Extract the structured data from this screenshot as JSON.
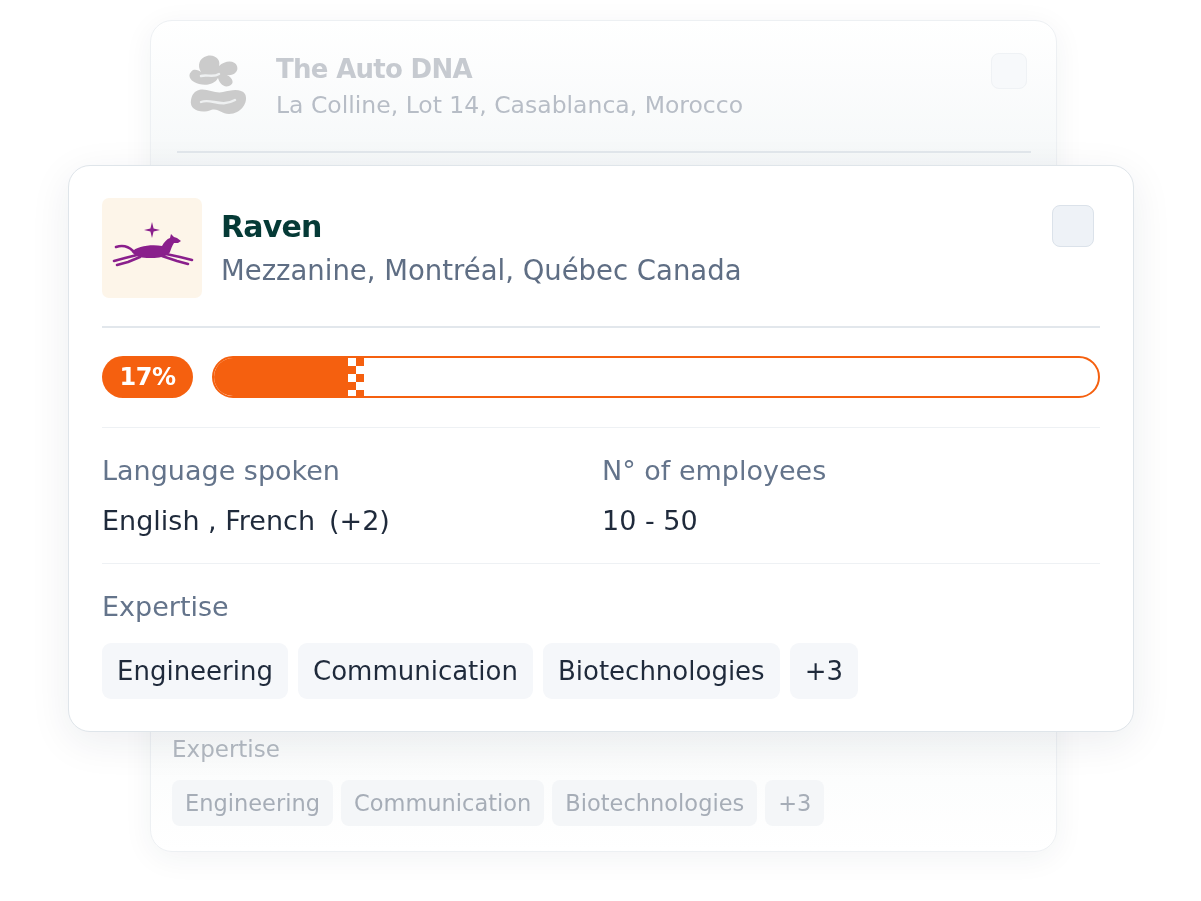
{
  "back_card": {
    "name": "The Auto DNA",
    "address": "La Colline, Lot 14, Casablanca, Morocco",
    "checked": false,
    "expertise": {
      "label": "Expertise",
      "tags": [
        "Engineering",
        "Communication",
        "Biotechnologies"
      ],
      "more": "+3"
    }
  },
  "front_card": {
    "name": "Raven",
    "address": "Mezzanine, Montréal, Québec Canada",
    "checked": false,
    "progress": {
      "label": "17%",
      "level": 0.17
    },
    "details": [
      {
        "label": "Language spoken",
        "value": "English , French",
        "extra": "(+2)"
      },
      {
        "label": "N° of employees",
        "value": "10 - 50"
      }
    ],
    "expertise": {
      "label": "Expertise",
      "tags": [
        "Engineering",
        "Communication",
        "Biotechnologies"
      ],
      "more": "+3"
    }
  }
}
